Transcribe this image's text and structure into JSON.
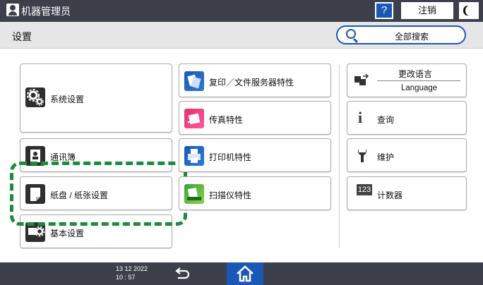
{
  "topbar": {
    "user_label": "机器管理员",
    "help_label": "?",
    "logout_label": "注销"
  },
  "header": {
    "title": "设置",
    "search_label": "全部搜索"
  },
  "tiles": {
    "system_settings": "系统设置",
    "address_book": "通讯簿",
    "tray_paper": "纸盘 / 纸张设置",
    "basic_settings": "基本设置",
    "copier_doc_server": "复印／文件服务器特性",
    "fax": "传真特性",
    "printer": "打印机特性",
    "scanner": "扫描仪特性",
    "change_language_top": "更改语言",
    "change_language_bottom": "Language",
    "inquiry": "查询",
    "maintenance": "维护",
    "counter_badge": "123",
    "counter": "计数器"
  },
  "footer": {
    "date": "13 12 2022",
    "time": "10 : 57"
  },
  "icons": {
    "user": "user-icon",
    "help": "question-mark-icon",
    "night_mode": "moon-icon",
    "search": "search-icon",
    "back": "back-arrow-icon",
    "home": "home-icon"
  },
  "colors": {
    "bar_bg": "#3d3f4a",
    "accent_blue": "#1b57b6",
    "highlight_green": "#1e8a3c",
    "title_row_bg": "#e6e6e6"
  }
}
